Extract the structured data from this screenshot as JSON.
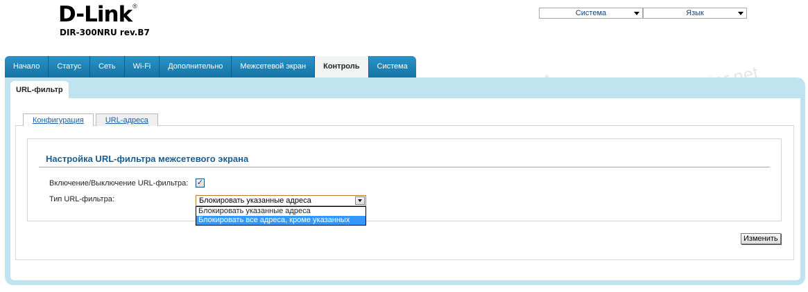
{
  "brand": {
    "logo_text": "D-Link",
    "reg_mark": "®",
    "model": "DIR-300NRU rev.B7"
  },
  "top_selects": [
    {
      "label": "Система"
    },
    {
      "label": "Язык"
    }
  ],
  "main_tabs": [
    "Начало",
    "Статус",
    "Сеть",
    "Wi-Fi",
    "Дополнительно",
    "Межсетевой экран",
    "Контроль",
    "Система"
  ],
  "active_tab": "Контроль",
  "subsection_tab": "URL-фильтр",
  "inner_tabs": {
    "config": "Конфигурация",
    "urls": "URL-адреса"
  },
  "section": {
    "title": "Настройка URL-фильтра межсетевого экрана",
    "enable_label": "Включение/Выключение URL-фильтра:",
    "enable_checked": true,
    "type_label": "Тип URL-фильтра:",
    "type_value": "Блокировать указанные адреса",
    "type_options": [
      "Блокировать указанные адреса",
      "Блокировать все адреса, кроме указанных"
    ],
    "highlighted_option": "Блокировать все адреса, кроме указанных"
  },
  "apply_button": "Изменить",
  "watermark": {
    "site": "ivstar.net",
    "brand": "ИВСТАР"
  },
  "colors": {
    "tab_blue": "#1e86bb",
    "frame_blue": "#bfe3ef",
    "title_blue": "#1b5c8f",
    "highlight": "#3399ff"
  }
}
